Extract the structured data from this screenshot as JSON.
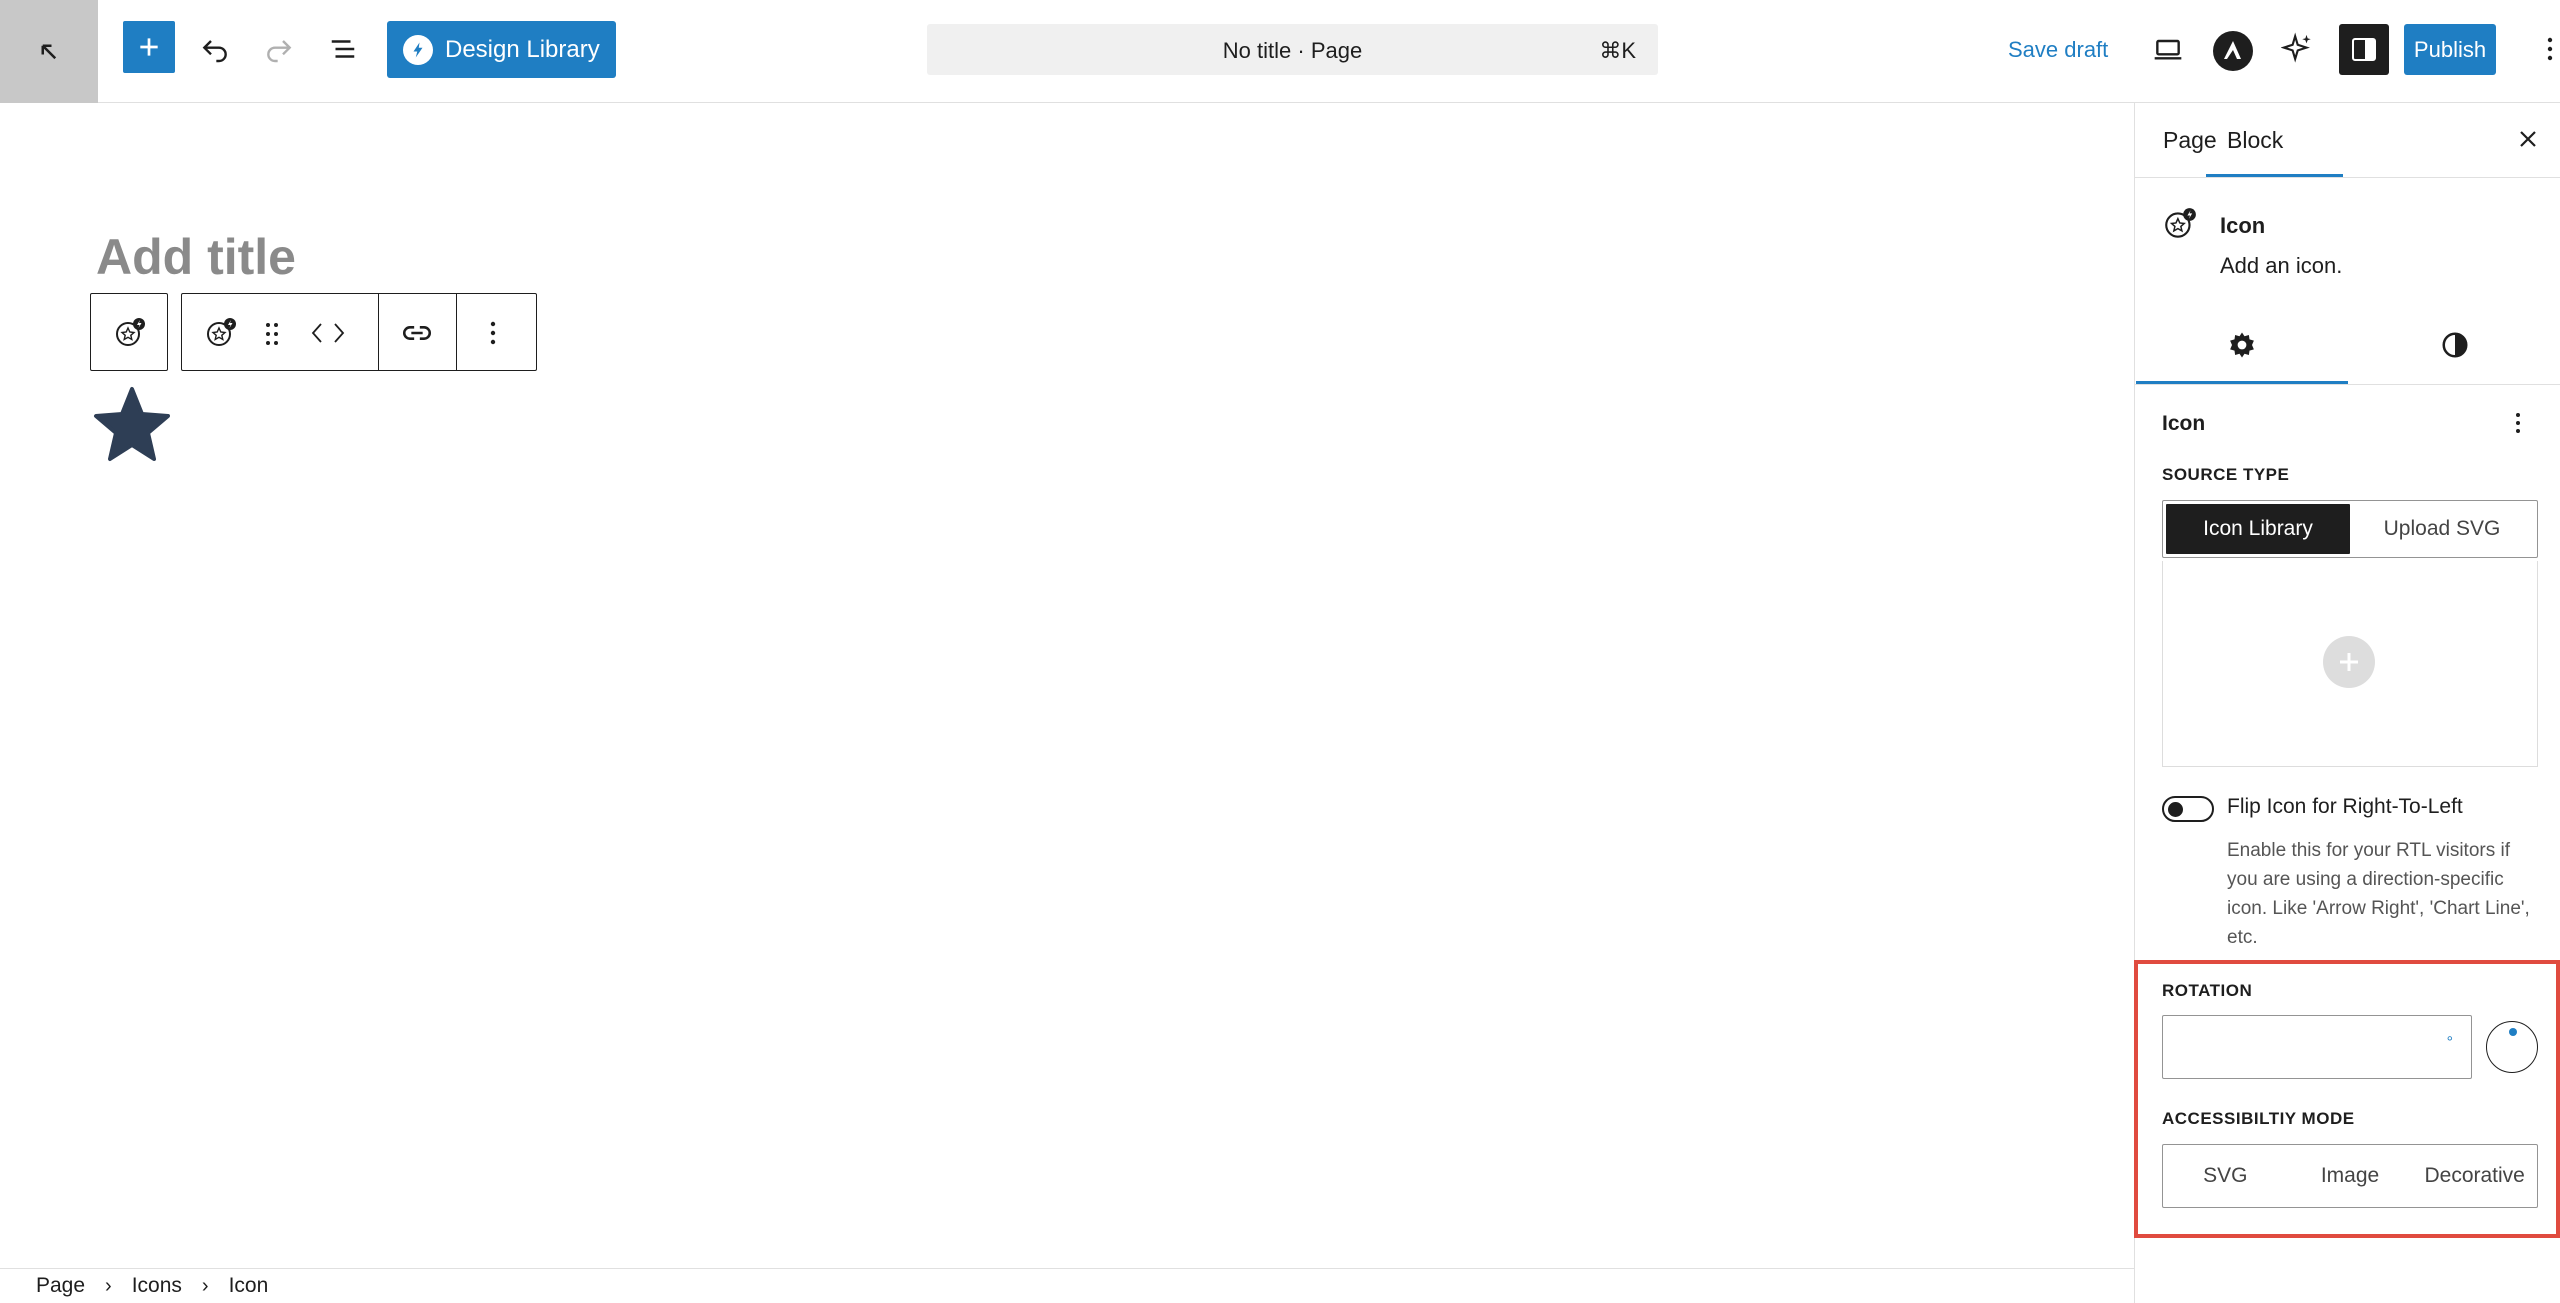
{
  "topbar": {
    "design_library": "Design Library",
    "doc_title": "No title · Page",
    "shortcut": "⌘K",
    "save_draft": "Save draft",
    "publish": "Publish"
  },
  "editor": {
    "title_placeholder": "Add title"
  },
  "breadcrumb": [
    "Page",
    "Icons",
    "Icon"
  ],
  "sidebar": {
    "tabs": [
      "Page",
      "Block"
    ],
    "active_tab": "Block",
    "block_name": "Icon",
    "block_desc": "Add an icon.",
    "panel_title": "Icon",
    "source_type_label": "SOURCE TYPE",
    "source_options": [
      "Icon Library",
      "Upload SVG"
    ],
    "source_selected": "Icon Library",
    "flip_label": "Flip Icon for Right-To-Left",
    "flip_help": "Enable this for your RTL visitors if you are using a direction-specific icon. Like 'Arrow Right', 'Chart Line', etc.",
    "rotation_label": "ROTATION",
    "rotation_value": "",
    "rotation_unit": "°",
    "accessibility_label": "ACCESSIBILTIY MODE",
    "accessibility_options": [
      "SVG",
      "Image",
      "Decorative"
    ]
  },
  "colors": {
    "accent": "#1f7ec3",
    "highlight": "#e04b3f",
    "star": "#2e3e55"
  }
}
